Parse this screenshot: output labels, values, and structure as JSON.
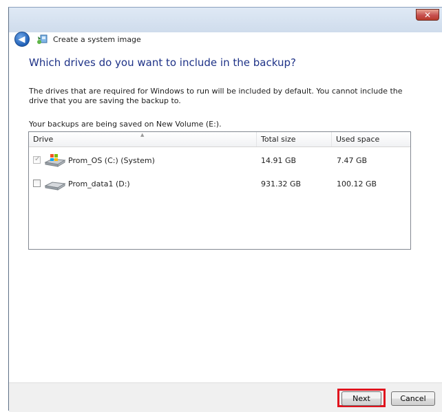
{
  "window": {
    "close_glyph": "✕",
    "title": "Create a system image"
  },
  "heading": "Which drives do you want to include in the backup?",
  "description": "The drives that are required for Windows to run will be included by default. You cannot include the drive that you are saving the backup to.",
  "saved_to": "Your backups are being saved on New Volume (E:).",
  "table": {
    "columns": [
      "Drive",
      "Total size",
      "Used space"
    ],
    "rows": [
      {
        "drive": "Prom_OS (C:) (System)",
        "total": "14.91 GB",
        "used": "7.47 GB",
        "checked": true,
        "disabled": true,
        "icon": "windows-drive-icon"
      },
      {
        "drive": "Prom_data1 (D:)",
        "total": "931.32 GB",
        "used": "100.12 GB",
        "checked": false,
        "disabled": false,
        "icon": "hard-drive-icon"
      }
    ]
  },
  "buttons": {
    "next": "Next",
    "cancel": "Cancel"
  },
  "colors": {
    "heading": "#1e3287",
    "highlight": "#e0141e"
  }
}
